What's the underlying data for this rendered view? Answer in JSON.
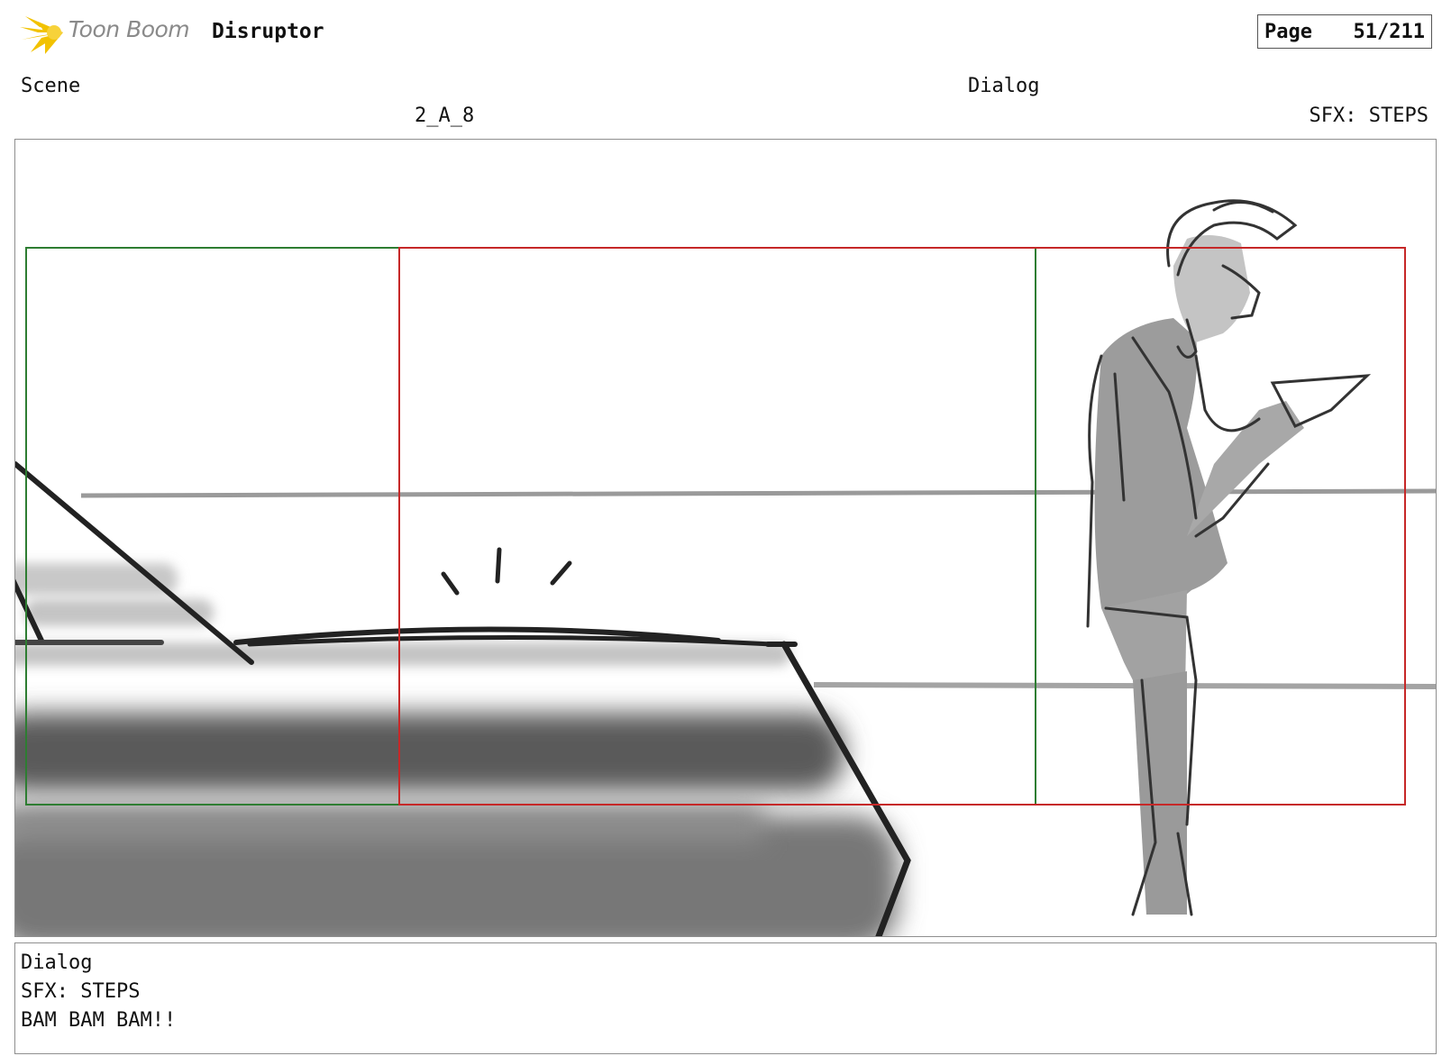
{
  "header": {
    "brand": "Toon Boom",
    "app_title": "Disruptor",
    "page_label": "Page",
    "page_number": "51/211"
  },
  "fields": {
    "scene_label": "Scene",
    "scene_value": "2_A_8",
    "dialog_label": "Dialog",
    "dialog_value": "SFX: STEPS"
  },
  "notes": {
    "title": "Dialog",
    "lines": [
      "SFX: STEPS",
      "BAM BAM BAM!!"
    ]
  },
  "colors": {
    "logo_yellow": "#f2c200",
    "safe_frame_green": "#2e7d32",
    "camera_frame_red": "#c62828",
    "sketch_gray": "#9a9a9a"
  },
  "icons": {
    "logo": "toon-boom-sunburst-icon"
  }
}
